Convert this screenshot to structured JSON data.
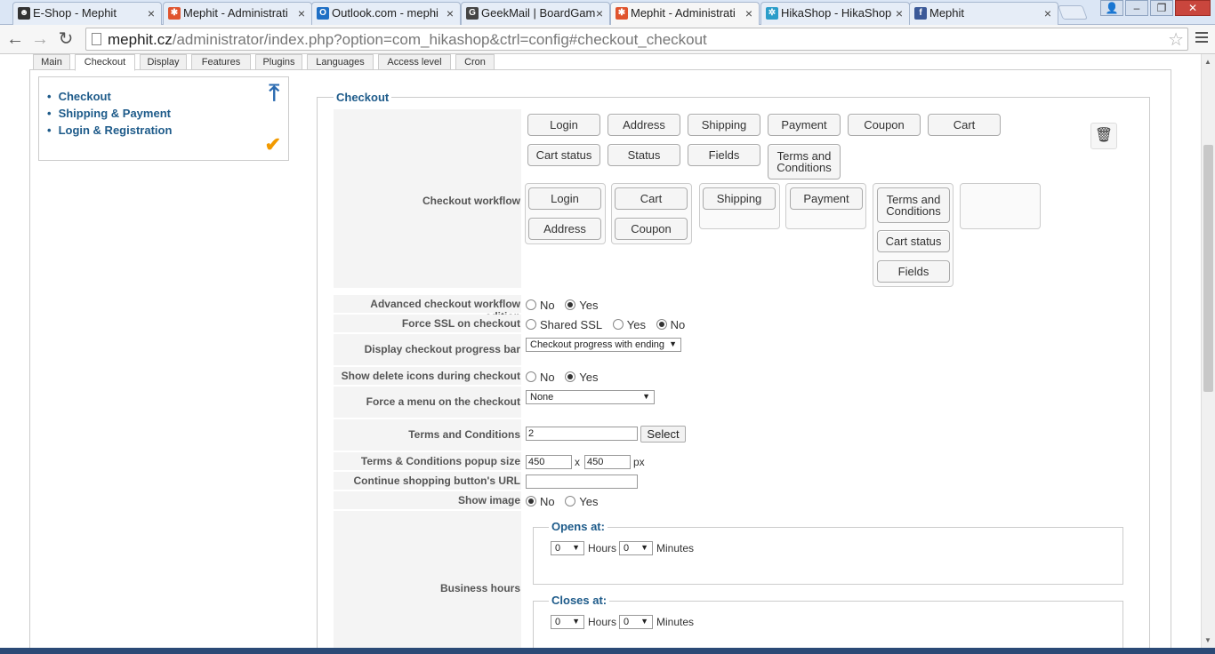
{
  "browser": {
    "tabs": [
      {
        "label": "E-Shop - Mephit",
        "icon": "person-silhouette-icon",
        "color": "#333333"
      },
      {
        "label": "Mephit - Administrati",
        "icon": "joomla-icon",
        "color": "#e0542e"
      },
      {
        "label": "Outlook.com - mephi",
        "icon": "outlook-icon",
        "color": "#1f6fc5"
      },
      {
        "label": "GeekMail | BoardGam",
        "icon": "geekmail-icon",
        "color": "#444444"
      },
      {
        "label": "Mephit - Administrati",
        "icon": "joomla-icon",
        "color": "#e0542e"
      },
      {
        "label": "HikaShop - HikaShop",
        "icon": "hikashop-icon",
        "color": "#2a9dc9"
      },
      {
        "label": "Mephit",
        "icon": "facebook-icon",
        "color": "#3b5998"
      }
    ],
    "url_host": "mephit.cz",
    "url_path": "/administrator/index.php?option=com_hikashop&ctrl=config#checkout_checkout"
  },
  "config_tabs": [
    "Main",
    "Checkout",
    "Display",
    "Features",
    "Plugins",
    "Languages",
    "Access level",
    "Cron"
  ],
  "side_menu": [
    "Checkout",
    "Shipping & Payment",
    "Login & Registration"
  ],
  "checkout": {
    "legend": "Checkout",
    "available_items_row1": [
      "Login",
      "Address",
      "Shipping",
      "Payment",
      "Coupon",
      "Cart"
    ],
    "available_items_row2": [
      "Cart status",
      "Status",
      "Fields",
      "Terms and Conditions"
    ],
    "workflow_label": "Checkout workflow",
    "workflow_groups": [
      [
        "Login",
        "Address"
      ],
      [
        "Cart",
        "Coupon"
      ],
      [
        "Shipping"
      ],
      [
        "Payment"
      ],
      [
        "Terms and Conditions",
        "Cart status",
        "Fields"
      ],
      []
    ],
    "advanced_label": "Advanced checkout workflow edition",
    "advanced_options": [
      "No",
      "Yes"
    ],
    "ssl_label": "Force SSL on checkout",
    "ssl_options": [
      "Shared SSL",
      "Yes",
      "No"
    ],
    "progress_label": "Display checkout progress bar",
    "progress_value": "Checkout progress with ending",
    "delete_icons_label": "Show delete icons during checkout",
    "delete_icons_options": [
      "No",
      "Yes"
    ],
    "menu_label": "Force a menu on the checkout",
    "menu_value": "None",
    "terms_label": "Terms and Conditions",
    "terms_value": "2",
    "terms_button": "Select",
    "popup_label": "Terms & Conditions popup size",
    "popup_w": "450",
    "popup_x": "x",
    "popup_h": "450",
    "popup_unit": "px",
    "continue_label": "Continue shopping button's URL",
    "continue_value": "",
    "show_image_label": "Show image",
    "show_image_options": [
      "No",
      "Yes"
    ],
    "business_label": "Business hours",
    "opens_legend": "Opens at:",
    "closes_legend": "Closes at:",
    "hours_value": "0",
    "minutes_value": "0",
    "hours_text": "Hours",
    "minutes_text": "Minutes"
  }
}
